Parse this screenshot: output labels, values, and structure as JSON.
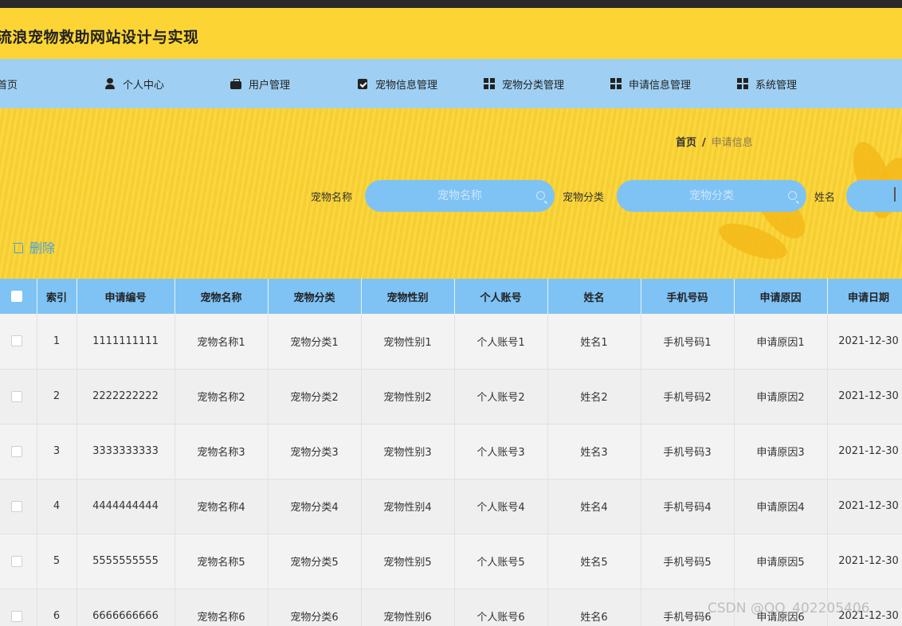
{
  "app": {
    "title": "流浪宠物救助网站设计与实现"
  },
  "nav": {
    "items": [
      {
        "label": "首页",
        "icon": "home-icon"
      },
      {
        "label": "个人中心",
        "icon": "user-icon"
      },
      {
        "label": "用户管理",
        "icon": "briefcase-icon"
      },
      {
        "label": "宠物信息管理",
        "icon": "clipboard-icon"
      },
      {
        "label": "宠物分类管理",
        "icon": "grid-icon"
      },
      {
        "label": "申请信息管理",
        "icon": "grid-icon"
      },
      {
        "label": "系统管理",
        "icon": "grid-icon"
      }
    ]
  },
  "breadcrumb": {
    "home": "首页",
    "separator": "/",
    "current": "申请信息"
  },
  "search": {
    "pet_name": {
      "label": "宠物名称",
      "placeholder": "宠物名称"
    },
    "pet_category": {
      "label": "宠物分类",
      "placeholder": "宠物分类"
    },
    "name": {
      "label": "姓名",
      "placeholder": ""
    }
  },
  "actions": {
    "delete_label": "删除"
  },
  "table": {
    "columns": [
      "",
      "索引",
      "申请编号",
      "宠物名称",
      "宠物分类",
      "宠物性别",
      "个人账号",
      "姓名",
      "手机号码",
      "申请原因",
      "申请日期"
    ],
    "rows": [
      [
        "1",
        "1111111111",
        "宠物名称1",
        "宠物分类1",
        "宠物性别1",
        "个人账号1",
        "姓名1",
        "手机号码1",
        "申请原因1",
        "2021-12-30"
      ],
      [
        "2",
        "2222222222",
        "宠物名称2",
        "宠物分类2",
        "宠物性别2",
        "个人账号2",
        "姓名2",
        "手机号码2",
        "申请原因2",
        "2021-12-30"
      ],
      [
        "3",
        "3333333333",
        "宠物名称3",
        "宠物分类3",
        "宠物性别3",
        "个人账号3",
        "姓名3",
        "手机号码3",
        "申请原因3",
        "2021-12-30"
      ],
      [
        "4",
        "4444444444",
        "宠物名称4",
        "宠物分类4",
        "宠物性别4",
        "个人账号4",
        "姓名4",
        "手机号码4",
        "申请原因4",
        "2021-12-30"
      ],
      [
        "5",
        "5555555555",
        "宠物名称5",
        "宠物分类5",
        "宠物性别5",
        "个人账号5",
        "姓名5",
        "手机号码5",
        "申请原因5",
        "2021-12-30"
      ],
      [
        "6",
        "6666666666",
        "宠物名称6",
        "宠物分类6",
        "宠物性别6",
        "个人账号6",
        "姓名6",
        "手机号码6",
        "申请原因6",
        "2021-12-30"
      ]
    ]
  },
  "watermark": "CSDN @QQ_402205406",
  "colors": {
    "header": "#fcd535",
    "nav": "#9fd0f3",
    "accent": "#7fc3f5",
    "link": "#4a9fe0"
  }
}
